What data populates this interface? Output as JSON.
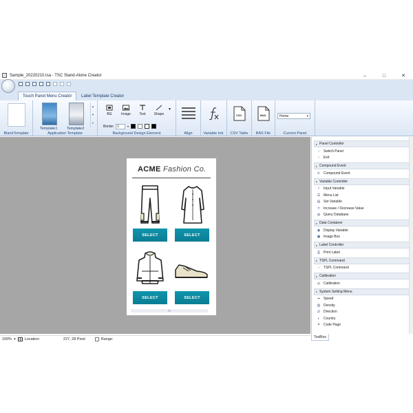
{
  "window": {
    "title": "Sample_20220210.tsa - TSC Stand-Alone Creator",
    "controls": [
      "–",
      "□",
      "✕"
    ]
  },
  "tabs": [
    {
      "label": "Touch Panel Menu Creator",
      "active": true
    },
    {
      "label": "Label Template Creator",
      "active": false
    }
  ],
  "ribbon": {
    "groups": {
      "blank_template": "BlankTemplate",
      "application_template": "Application Template",
      "background_design": "Background Design Element",
      "align": "Align",
      "variable_init": "Variable Init.",
      "csv_table": "CSV Table",
      "bas_file": "BAS File",
      "current_panel": "Current Panel"
    },
    "templates": [
      "Template1",
      "Template2"
    ],
    "bg_tools": [
      "BG",
      "Image",
      "Text",
      "Shape"
    ],
    "border_label": "Border",
    "border_value": "1",
    "csv_icon_text": "CSV",
    "bas_icon_text": "BAS",
    "current_panel_value": "Home"
  },
  "canvas": {
    "brand_bold": "ACME",
    "brand_italic": "Fashion Co.",
    "products": [
      {
        "icon": "pants-icon",
        "button": "SELECT"
      },
      {
        "icon": "dress-icon",
        "button": "SELECT"
      },
      {
        "icon": "jacket-icon",
        "button": "SELECT"
      },
      {
        "icon": "shoe-icon",
        "button": "SELECT"
      }
    ]
  },
  "toolbox": {
    "title": "ToolBox",
    "sections": [
      {
        "title": "Panel Controller",
        "items": [
          {
            "label": "Switch Panel",
            "icon": "chevron-right-icon"
          },
          {
            "label": "Exit",
            "icon": "chevron-left-icon"
          }
        ]
      },
      {
        "title": "Compound Event",
        "items": [
          {
            "label": "Compound Event",
            "icon": "compound-icon"
          }
        ]
      },
      {
        "title": "Variable Controller",
        "items": [
          {
            "label": "Input Variable",
            "icon": "text-cursor-icon"
          },
          {
            "label": "Menu List",
            "icon": "list-icon"
          },
          {
            "label": "Set Variable",
            "icon": "set-icon"
          },
          {
            "label": "Increase / Decrease Value",
            "icon": "plus-minus-icon"
          },
          {
            "label": "Query Database",
            "icon": "database-icon"
          }
        ]
      },
      {
        "title": "Data Container",
        "items": [
          {
            "label": "Display Variable",
            "icon": "eye-icon"
          },
          {
            "label": "Image Box",
            "icon": "image-icon"
          }
        ]
      },
      {
        "title": "Label Controller",
        "items": [
          {
            "label": "Print Label",
            "icon": "printer-icon"
          }
        ]
      },
      {
        "title": "TSPL Command",
        "items": [
          {
            "label": "TSPL Command",
            "icon": "chevron-right-icon"
          }
        ]
      },
      {
        "title": "Calibration",
        "items": [
          {
            "label": "Calibration",
            "icon": "target-icon"
          }
        ]
      },
      {
        "title": "System Setting Menu",
        "items": [
          {
            "label": "Speed",
            "icon": "speed-icon"
          },
          {
            "label": "Density",
            "icon": "density-icon"
          },
          {
            "label": "Direction",
            "icon": "direction-icon"
          },
          {
            "label": "Country",
            "icon": "globe-icon"
          },
          {
            "label": "Code Page",
            "icon": "code-icon"
          }
        ]
      }
    ]
  },
  "status": {
    "zoom": "100%",
    "location_label": "Location:",
    "location_value": "227, 28 Pixel",
    "range_label": "Range:"
  },
  "colors": {
    "select_button": "#0f94ad",
    "ribbon_bg": "#dce7f5",
    "workspace": "#a6a6a6"
  }
}
